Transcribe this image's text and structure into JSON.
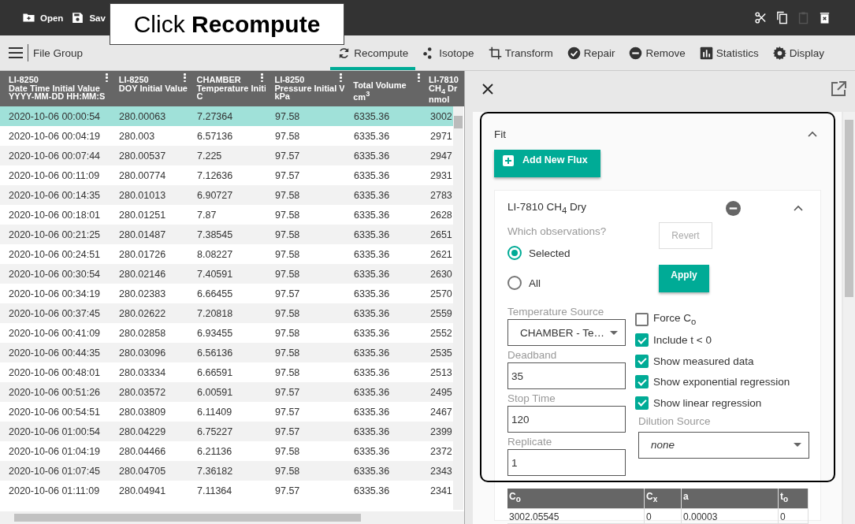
{
  "top_bar": {
    "buttons": [
      {
        "kind": "open",
        "label": "Open"
      },
      {
        "kind": "save",
        "label": "Sav"
      }
    ],
    "edit_actions": [
      {
        "kind": "cut",
        "disabled": false
      },
      {
        "kind": "copy",
        "disabled": false
      },
      {
        "kind": "paste",
        "disabled": true
      },
      {
        "kind": "delete",
        "disabled": false
      }
    ]
  },
  "callout": {
    "text": "Click **Recompute**"
  },
  "toolbar": {
    "menu_label": "File Group",
    "tabs": [
      {
        "kind": "sync",
        "label": "Recompute",
        "selected": true
      },
      {
        "kind": "dots",
        "label": "Isotope",
        "selected": false
      },
      {
        "kind": "crop",
        "label": "Transform",
        "selected": false
      },
      {
        "kind": "check",
        "label": "Repair",
        "selected": false
      },
      {
        "kind": "minus",
        "label": "Remove",
        "selected": false
      },
      {
        "kind": "stats",
        "label": "Statistics",
        "selected": false
      },
      {
        "kind": "gear",
        "label": "Display",
        "selected": false
      }
    ]
  },
  "table": {
    "columns": [
      {
        "lines": [
          "LI-8250",
          "Date Time Initial Value",
          "YYYY-MM-DD HH:MM:S"
        ]
      },
      {
        "lines": [
          "LI-8250",
          "DOY Initial Value"
        ]
      },
      {
        "lines": [
          "CHAMBER",
          "Temperature Initi",
          "C"
        ]
      },
      {
        "lines": [
          "LI-8250",
          "Pressure Initial V",
          "kPa"
        ]
      },
      {
        "lines": [
          "Total Volume",
          "cm$^{3}$"
        ]
      },
      {
        "lines": [
          "LI-7810",
          "CH$_{4}$ Dr",
          "nmol"
        ]
      }
    ],
    "rows": [
      {
        "selected": true,
        "cells": [
          "2020-10-06 00:00:54",
          "280.00063",
          "7.27364",
          "97.58",
          "6335.36",
          "3002"
        ]
      },
      {
        "selected": false,
        "cells": [
          "2020-10-06 00:04:19",
          "280.003",
          "6.57136",
          "97.58",
          "6335.36",
          "2971"
        ]
      },
      {
        "selected": false,
        "cells": [
          "2020-10-06 00:07:44",
          "280.00537",
          "7.225",
          "97.57",
          "6335.36",
          "2947"
        ]
      },
      {
        "selected": false,
        "cells": [
          "2020-10-06 00:11:09",
          "280.00774",
          "7.12636",
          "97.57",
          "6335.36",
          "2931"
        ]
      },
      {
        "selected": false,
        "cells": [
          "2020-10-06 00:14:35",
          "280.01013",
          "6.90727",
          "97.58",
          "6335.36",
          "2783"
        ]
      },
      {
        "selected": false,
        "cells": [
          "2020-10-06 00:18:01",
          "280.01251",
          "7.87",
          "97.58",
          "6335.36",
          "2628"
        ]
      },
      {
        "selected": false,
        "cells": [
          "2020-10-06 00:21:25",
          "280.01487",
          "7.38545",
          "97.58",
          "6335.36",
          "2651"
        ]
      },
      {
        "selected": false,
        "cells": [
          "2020-10-06 00:24:51",
          "280.01726",
          "8.08227",
          "97.58",
          "6335.36",
          "2621"
        ]
      },
      {
        "selected": false,
        "cells": [
          "2020-10-06 00:30:54",
          "280.02146",
          "7.40591",
          "97.58",
          "6335.36",
          "2630"
        ]
      },
      {
        "selected": false,
        "cells": [
          "2020-10-06 00:34:19",
          "280.02383",
          "6.66455",
          "97.57",
          "6335.36",
          "2570"
        ]
      },
      {
        "selected": false,
        "cells": [
          "2020-10-06 00:37:45",
          "280.02622",
          "7.20818",
          "97.58",
          "6335.36",
          "2559"
        ]
      },
      {
        "selected": false,
        "cells": [
          "2020-10-06 00:41:09",
          "280.02858",
          "6.93455",
          "97.58",
          "6335.36",
          "2552"
        ]
      },
      {
        "selected": false,
        "cells": [
          "2020-10-06 00:44:35",
          "280.03096",
          "6.56136",
          "97.58",
          "6335.36",
          "2535"
        ]
      },
      {
        "selected": false,
        "cells": [
          "2020-10-06 00:48:01",
          "280.03334",
          "6.66591",
          "97.58",
          "6335.36",
          "2513"
        ]
      },
      {
        "selected": false,
        "cells": [
          "2020-10-06 00:51:26",
          "280.03572",
          "6.00591",
          "97.57",
          "6335.36",
          "2495"
        ]
      },
      {
        "selected": false,
        "cells": [
          "2020-10-06 00:54:51",
          "280.03809",
          "6.11409",
          "97.57",
          "6335.36",
          "2467"
        ]
      },
      {
        "selected": false,
        "cells": [
          "2020-10-06 01:00:54",
          "280.04229",
          "6.75227",
          "97.57",
          "6335.36",
          "2399"
        ]
      },
      {
        "selected": false,
        "cells": [
          "2020-10-06 01:04:19",
          "280.04466",
          "6.21136",
          "97.58",
          "6335.36",
          "2372"
        ]
      },
      {
        "selected": false,
        "cells": [
          "2020-10-06 01:07:45",
          "280.04705",
          "7.36182",
          "97.58",
          "6335.36",
          "2343"
        ]
      },
      {
        "selected": false,
        "cells": [
          "2020-10-06 01:11:09",
          "280.04941",
          "7.11364",
          "97.57",
          "6335.36",
          "2341"
        ]
      }
    ]
  },
  "panel": {
    "section_title": "Fit",
    "add_button": "Add New Flux",
    "flux": {
      "title": "LI-7810 CH$_{4}$ Dry",
      "observations_label": "Which observations?",
      "radios": [
        {
          "label": "Selected",
          "selected": true
        },
        {
          "label": "All",
          "selected": false
        }
      ],
      "buttons": [
        {
          "label": "Revert",
          "disabled": true
        },
        {
          "label": "Apply",
          "disabled": false
        }
      ],
      "fields": [
        {
          "kind": "select",
          "label": "Temperature Source",
          "value": "CHAMBER - Te…"
        },
        {
          "kind": "input",
          "label": "Deadband",
          "value": "35"
        },
        {
          "kind": "input",
          "label": "Stop Time",
          "value": "120"
        },
        {
          "kind": "input",
          "label": "Replicate",
          "value": "1"
        }
      ],
      "checkboxes": [
        {
          "label": "Force C$_{o}$",
          "checked": false
        },
        {
          "label": "Include t < 0",
          "checked": true
        },
        {
          "label": "Show measured data",
          "checked": true
        },
        {
          "label": "Show exponential regression",
          "checked": true
        },
        {
          "label": "Show linear regression",
          "checked": true
        }
      ],
      "dilution": {
        "label": "Dilution Source",
        "value": "none"
      },
      "results": {
        "columns": [
          "C$_{o}$",
          "C$_{x}$",
          "a",
          "t$_{o}$"
        ],
        "rows": [
          [
            "3002.05545",
            "0",
            "0.00003",
            "0"
          ]
        ]
      }
    }
  }
}
